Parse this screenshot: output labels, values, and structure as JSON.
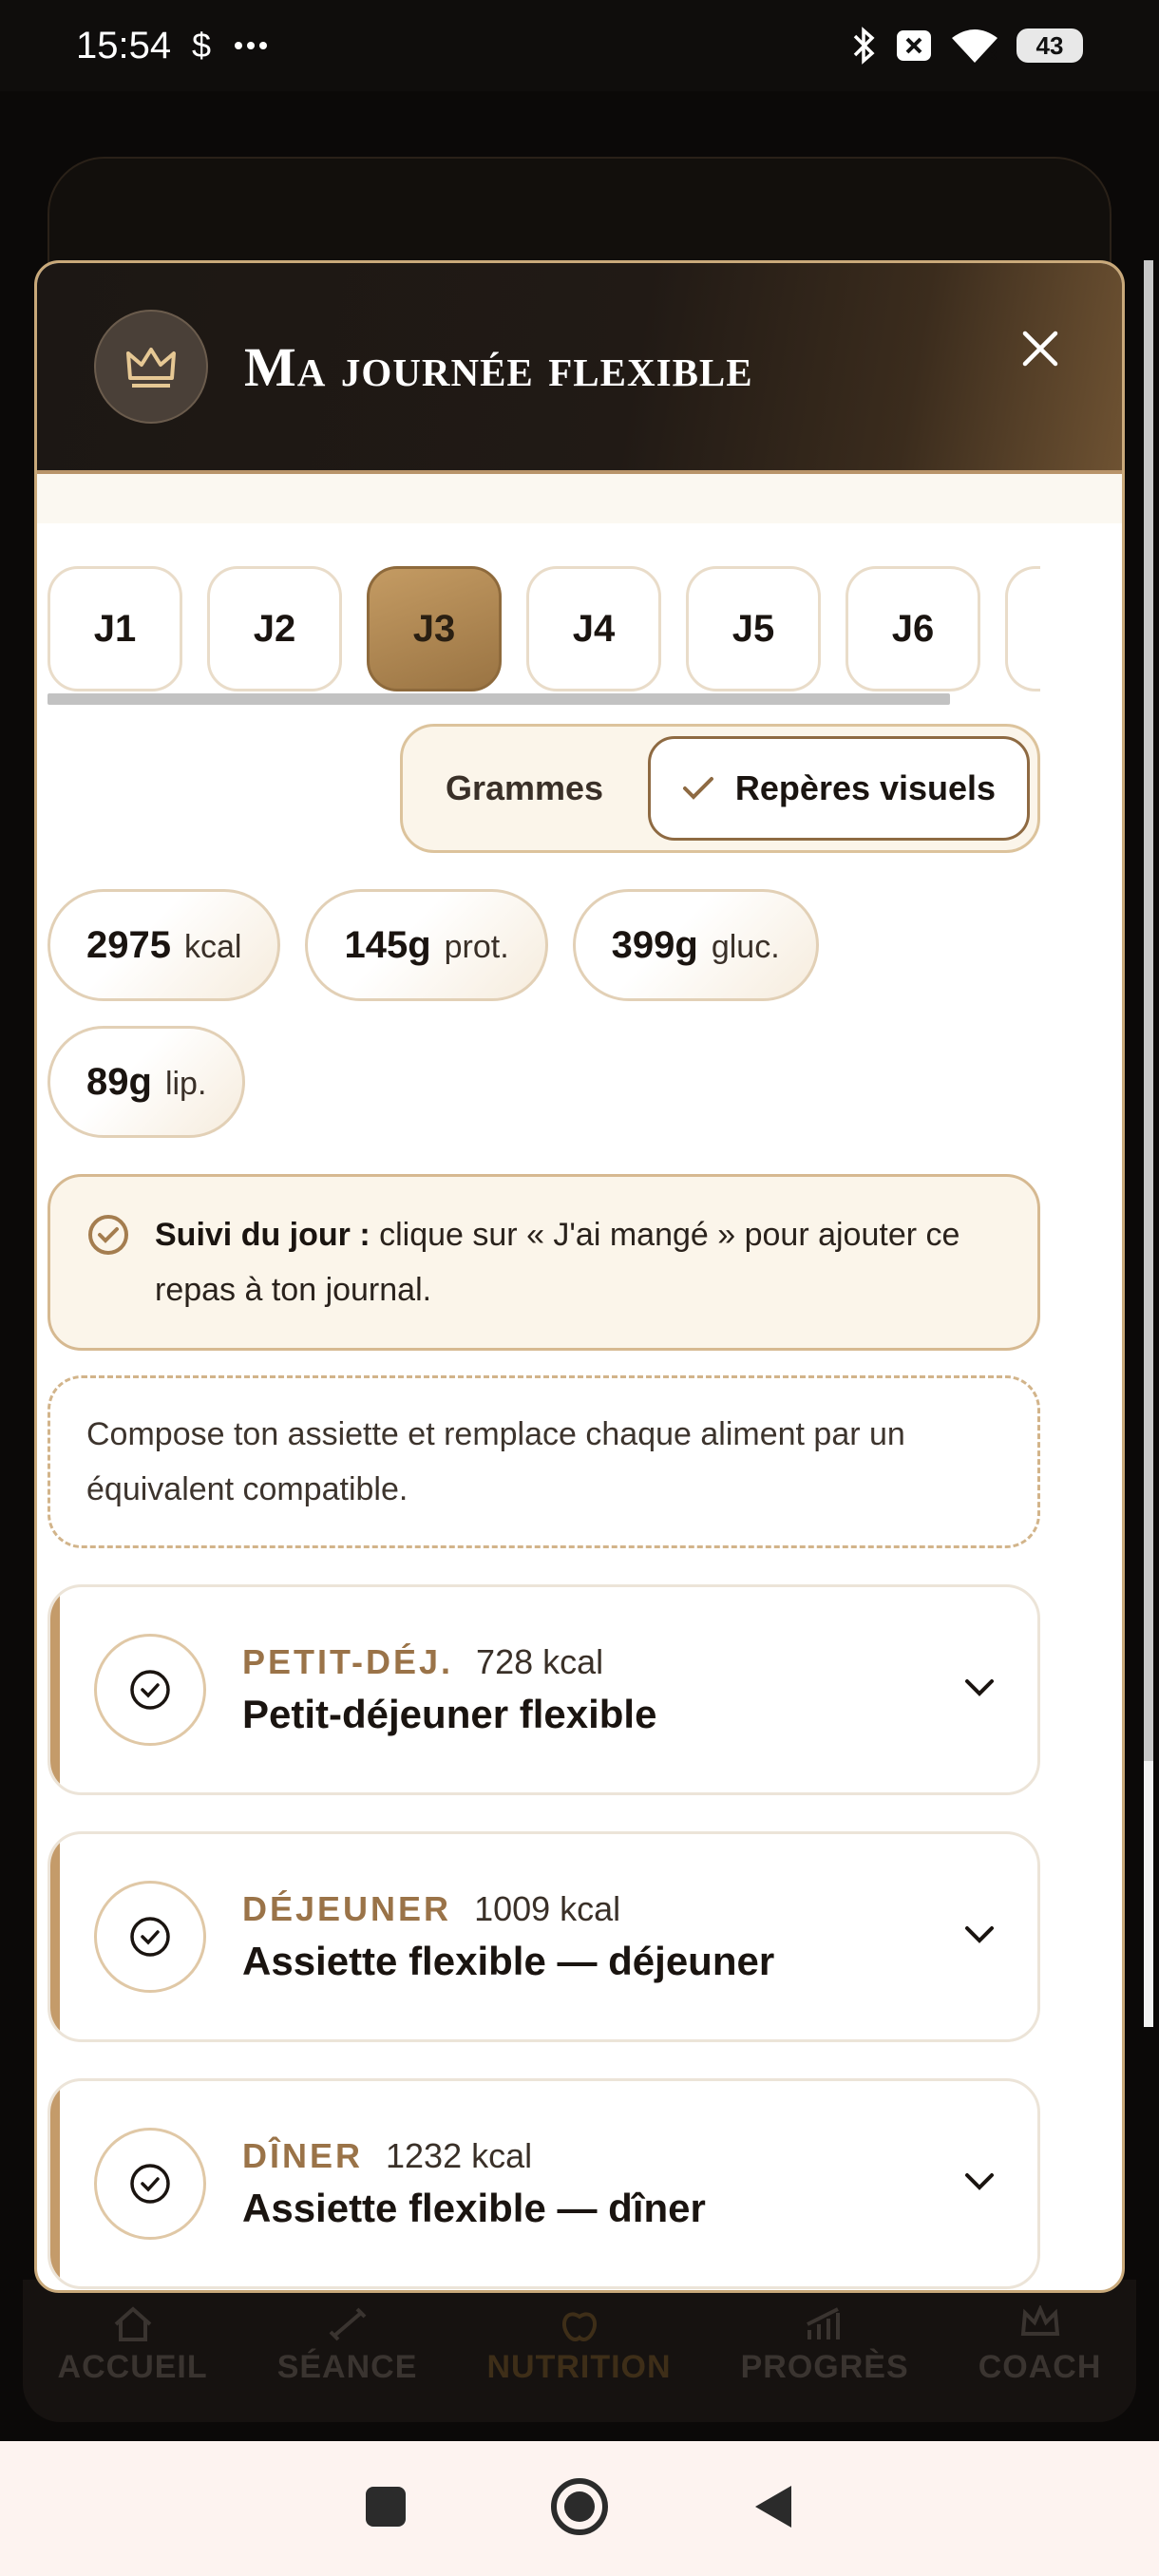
{
  "status_bar": {
    "time": "15:54",
    "left_icons": [
      "dollar-icon",
      "more-dots-icon"
    ],
    "right_icons": [
      "bluetooth-icon",
      "no-sim-icon",
      "wifi-icon"
    ],
    "battery": "43"
  },
  "modal": {
    "title": "Ma journée flexible",
    "crown_icon": "crown-icon",
    "close_icon": "close-icon"
  },
  "day_tabs": [
    {
      "label": "J1",
      "active": false
    },
    {
      "label": "J2",
      "active": false
    },
    {
      "label": "J3",
      "active": true
    },
    {
      "label": "J4",
      "active": false
    },
    {
      "label": "J5",
      "active": false
    },
    {
      "label": "J6",
      "active": false
    }
  ],
  "view_toggle": {
    "option_grams": "Grammes",
    "option_visual": "Repères visuels",
    "selected": "Repères visuels"
  },
  "macros": [
    {
      "value": "2975",
      "unit": "kcal"
    },
    {
      "value": "145g",
      "unit": "prot."
    },
    {
      "value": "399g",
      "unit": "gluc."
    },
    {
      "value": "89g",
      "unit": "lip."
    }
  ],
  "tracking_info": {
    "bold": "Suivi du jour :",
    "text": " clique sur « J'ai mangé » pour ajouter ce repas à ton journal."
  },
  "compose_hint": "Compose ton assiette et remplace chaque aliment par un équivalent compatible.",
  "meals": [
    {
      "category": "PETIT-DÉJ.",
      "kcal": "728 kcal",
      "name": "Petit-déjeuner flexible"
    },
    {
      "category": "DÉJEUNER",
      "kcal": "1009 kcal",
      "name": "Assiette flexible — déjeuner"
    },
    {
      "category": "DÎNER",
      "kcal": "1232 kcal",
      "name": "Assiette flexible — dîner"
    }
  ],
  "bottom_nav": [
    {
      "label": "ACCUEIL",
      "icon": "home-icon"
    },
    {
      "label": "SÉANCE",
      "icon": "dumbbell-icon"
    },
    {
      "label": "NUTRITION",
      "icon": "apple-icon"
    },
    {
      "label": "PROGRÈS",
      "icon": "chart-icon"
    },
    {
      "label": "COACH",
      "icon": "crown-icon"
    }
  ],
  "colors": {
    "accent_gold": "#c49b63",
    "header_dark": "#1c1714",
    "cream": "#fbf5ea"
  }
}
